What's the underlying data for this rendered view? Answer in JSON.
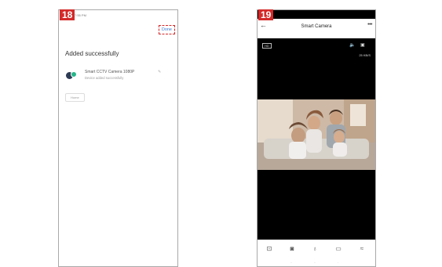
{
  "screen18": {
    "step": "18",
    "status_time": "7:55 PM",
    "status_icons": "",
    "done_label": "Done",
    "title": "Added successfully",
    "device_name": "Smart CCTV Camera 1080P",
    "device_status": "Device added successfully",
    "room_label": "Home"
  },
  "screen19": {
    "step": "19",
    "status_left": "",
    "status_icons": "",
    "title": "Smart Camera",
    "more": "•••",
    "hd_label": "HD",
    "bitrate": "25 KB/S",
    "overlay_timestamp": ""
  },
  "colors": {
    "badge": "#d42a2a",
    "done_link": "#3b7bd6",
    "camera_lens": "#26b588"
  }
}
